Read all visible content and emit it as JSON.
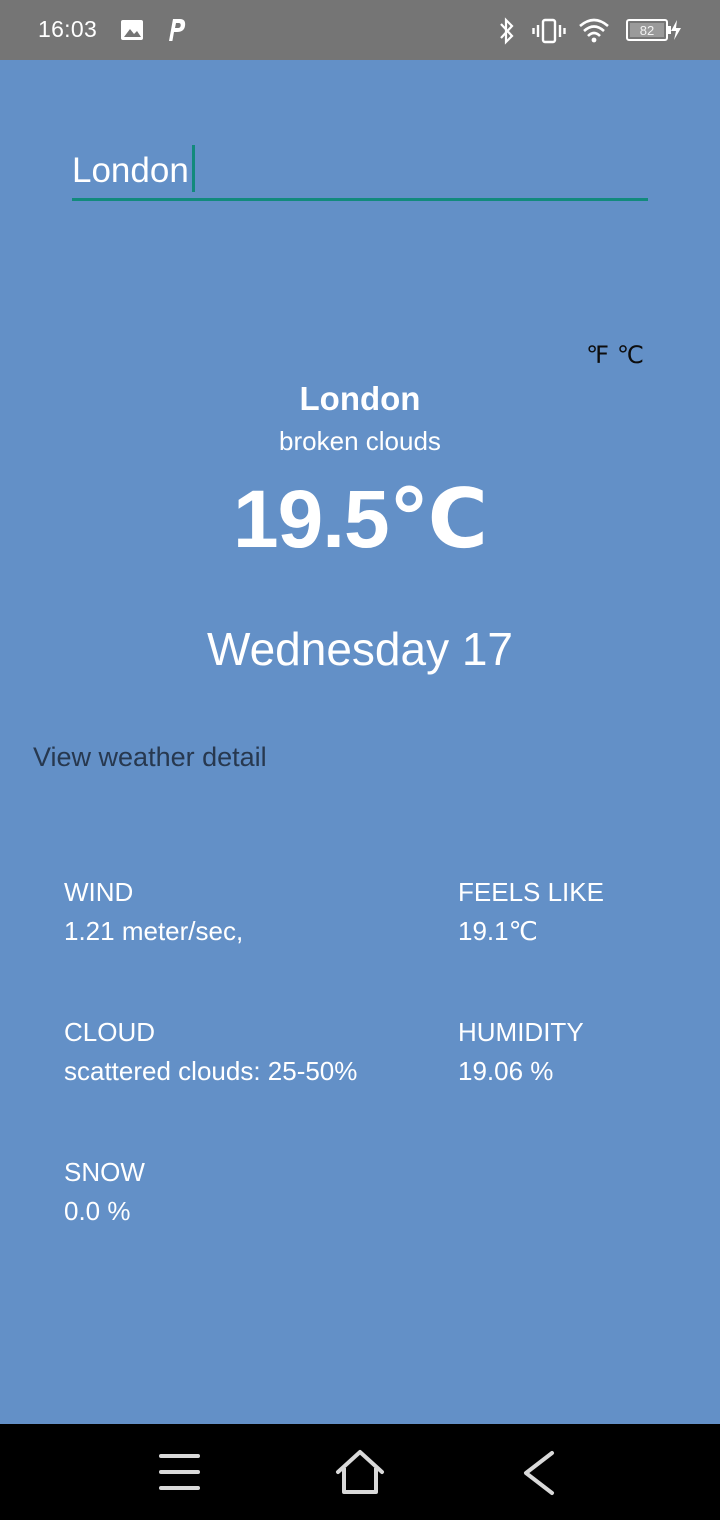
{
  "status_bar": {
    "time": "16:03",
    "battery": "82",
    "icons": [
      "image-icon",
      "p-app-icon",
      "bluetooth-icon",
      "vibrate-icon",
      "wifi-icon",
      "battery-icon",
      "charging-icon"
    ]
  },
  "search": {
    "value": "London"
  },
  "units": {
    "fahrenheit": "℉",
    "celsius": "℃"
  },
  "weather": {
    "city": "London",
    "condition": "broken clouds",
    "temperature": "19.5℃",
    "date": "Wednesday 17"
  },
  "detail_link": "View weather detail",
  "details": {
    "wind_label": "WIND",
    "wind_value": "1.21 meter/sec,",
    "feels_like_label": "FEELS LIKE",
    "feels_like_value": "19.1℃",
    "cloud_label": "CLOUD",
    "cloud_value": "scattered clouds: 25-50%",
    "humidity_label": "HUMIDITY",
    "humidity_value": "19.06 %",
    "snow_label": "SNOW",
    "snow_value": "0.0 %"
  },
  "colors": {
    "background": "#6390c7",
    "accent": "#128a7c",
    "status_bar": "#757575",
    "link": "#27384f"
  },
  "nav": {
    "icons": [
      "menu-icon",
      "home-icon",
      "back-icon"
    ]
  }
}
